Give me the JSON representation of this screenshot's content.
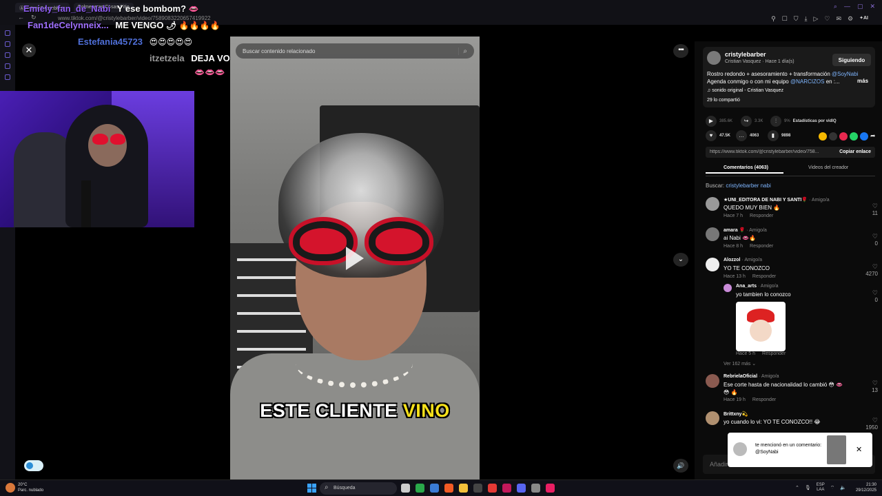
{
  "browser": {
    "tabs": [
      "Ⓐ Antena8 rosebloss",
      "Colmeneras Cosas Sitio"
    ],
    "url": "www.tiktok.com/@cristylebarber/video/7589083220657419922"
  },
  "stream_chat": [
    {
      "user": "Emiely_fan_de_Nabi",
      "message": "Y ese bombom?",
      "user_color": "#8e5cf0",
      "emoji": "👄"
    },
    {
      "user": "Fan1deCelynneix...",
      "message": "ME VENGO",
      "user_color": "#a070ff",
      "emoji": "🌶 🔥🔥🔥🔥"
    },
    {
      "user": "Estefania45723",
      "message": "",
      "user_color": "#4f6fd8",
      "emoji": "😍😍😍😍😍"
    },
    {
      "user": "itzetzela",
      "message": "DEJA VOY",
      "user_color": "#9a9a9a",
      "emoji": "👄👄👄"
    }
  ],
  "video": {
    "search_placeholder": "Buscar contenido relacionado",
    "caption_pre": "ESTE CLIENTE",
    "caption_highlight": "VINO"
  },
  "creator_card": {
    "username": "cristylebarber",
    "subtitle": "Cristian Vasquez · Hace 1 día(s)",
    "follow_label": "Siguiendo",
    "desc_line1": "Rostro redondo + asesoramiento + transformación",
    "desc_mention1": "@SoyNabi",
    "desc_line2": "Agenda conmigo o con mi equipo",
    "desc_mention2": "@NARCIZOS",
    "desc_line2_end": "en :...",
    "more_label": "más",
    "sound": "♫  sonido original - Cristian Vasquez",
    "shared": "29 lo compartió"
  },
  "stats": {
    "plays": "385.6K",
    "shares": "3.3K",
    "share_pct": "9%",
    "vidiq_label": "Estadísticas por vidIQ",
    "likes": "47.5K",
    "comments": "4063",
    "saves": "9898"
  },
  "link": {
    "url": "https://www.tiktok.com/@cristylebarber/video/758...",
    "copy_label": "Copiar enlace"
  },
  "tabs": {
    "comments": "Comentarios (4063)",
    "creator_videos": "Videos del creador"
  },
  "search_hint": {
    "label": "Buscar:",
    "query": "cristylebarber nabi"
  },
  "comments": [
    {
      "author": "★UNI_EDITORA DE NABI Y SANTI🌹",
      "tag": "· Amigo/a",
      "text": "QUEDO MUY BIEN 🔥",
      "time": "Hace 7 h",
      "reply": "Responder",
      "likes": "11"
    },
    {
      "author": "amara 🌹",
      "tag": "· Amigo/a",
      "text": "ai Nabi 👄🔥",
      "time": "Hace 8 h",
      "reply": "Responder",
      "likes": "0"
    },
    {
      "author": "Alozzol",
      "tag": "· Amigo/a",
      "text": "YO TE CONOZCO",
      "time": "Hace 13 h",
      "reply": "Responder",
      "likes": "4270"
    },
    {
      "author": "RebrielaOficial",
      "tag": "· Amigo/a",
      "text": "Ese corte hasta de nacionalidad lo cambió 😳 👄😳 🔥",
      "time": "Hace 19 h",
      "reply": "Responder",
      "likes": "13"
    },
    {
      "author": "Brittxny💫",
      "tag": "",
      "text": "yo cuando lo vi: YO TE CONOZCO!! 😂",
      "time": "",
      "reply": "",
      "likes": "1950"
    }
  ],
  "nested_reply": {
    "author": "Ana_arts",
    "tag": "· Amigo/a",
    "text": "yo tambien lo conozco",
    "time": "Hace 5 h",
    "reply": "Responder",
    "likes": "0"
  },
  "view_more": "Ver 162 más ⌄",
  "add_comment_placeholder": "Añadir comentario...",
  "toast": {
    "message": "te mencionó en un comentario: @SoyNabi"
  },
  "taskbar": {
    "temp": "20°C",
    "weather": "Parc. nublado",
    "search": "Búsqueda",
    "lang1": "ESP",
    "lang2": "LAA",
    "time": "21:30",
    "date": "29/12/2025"
  },
  "colors": {
    "accent_link": "#7fb6ff",
    "caption_highlight": "#f7e11a",
    "stream_purple": "#8e5cf0"
  }
}
